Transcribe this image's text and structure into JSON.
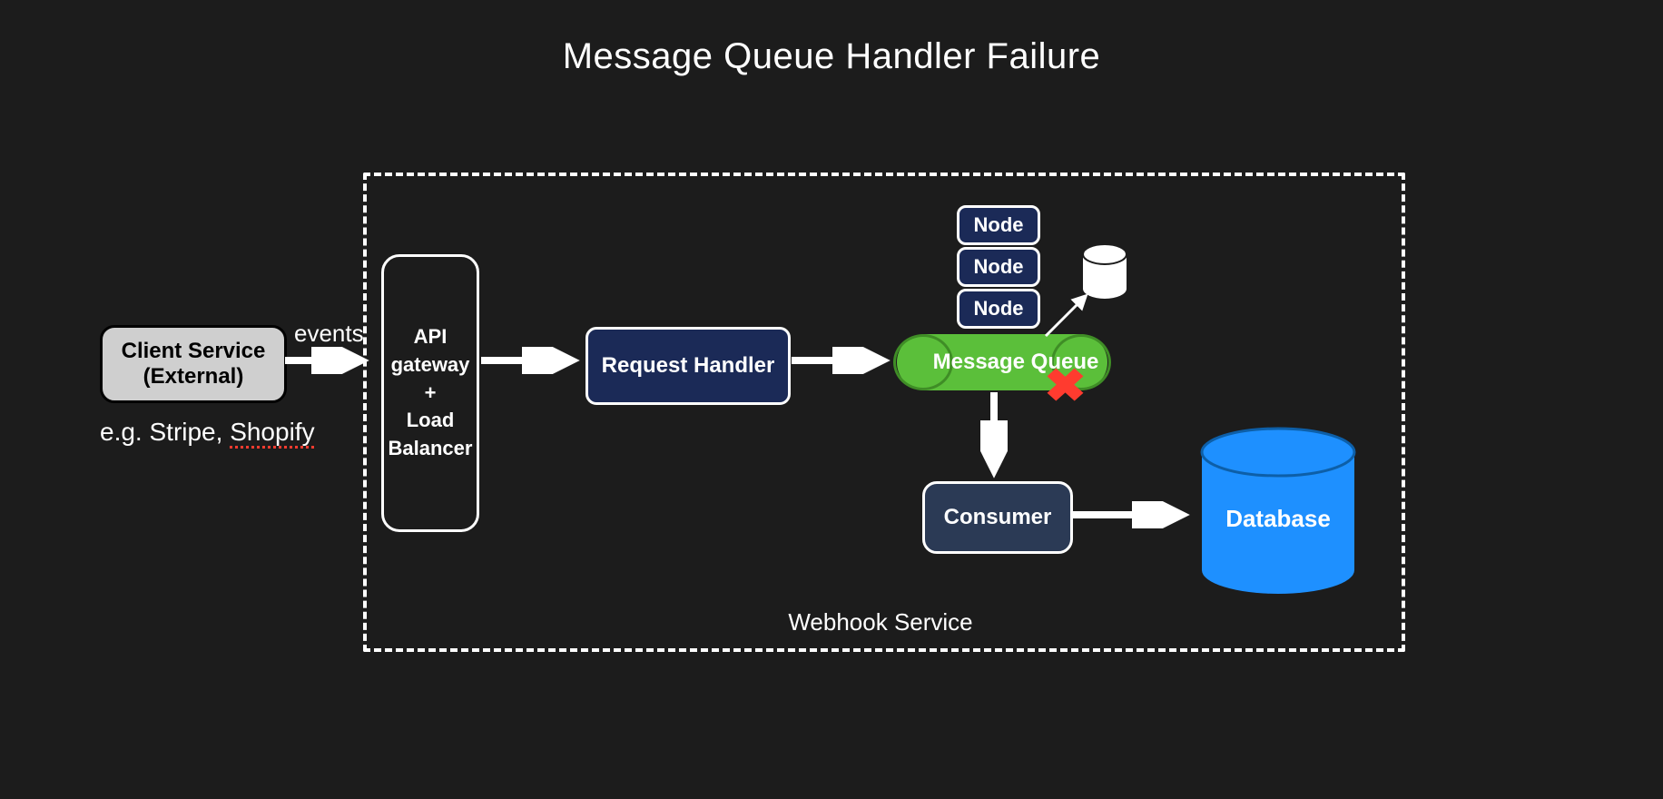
{
  "title": "Message Queue Handler Failure",
  "client": {
    "label": "Client Service\n(External)",
    "examples_prefix": "e.g. Stripe, ",
    "examples_marked": "Shopify"
  },
  "labels": {
    "events": "events",
    "webhook_service": "Webhook Service"
  },
  "gateway": {
    "label": "API\ngateway\n+\nLoad\nBalancer"
  },
  "request_handler": {
    "label": "Request Handler"
  },
  "nodes": [
    "Node",
    "Node",
    "Node"
  ],
  "queue": {
    "label": "Message Queue"
  },
  "consumer": {
    "label": "Consumer"
  },
  "database": {
    "label": "Database"
  },
  "diagram": {
    "type": "architecture",
    "container": "Webhook Service",
    "components": [
      {
        "id": "client",
        "name": "Client Service (External)",
        "note": "e.g. Stripe, Shopify"
      },
      {
        "id": "gateway",
        "name": "API gateway + Load Balancer"
      },
      {
        "id": "request_handler",
        "name": "Request Handler"
      },
      {
        "id": "message_queue",
        "name": "Message Queue",
        "replicas": [
          "Node",
          "Node",
          "Node"
        ],
        "persistence": true,
        "status": "failure"
      },
      {
        "id": "consumer",
        "name": "Consumer"
      },
      {
        "id": "database",
        "name": "Database"
      }
    ],
    "edges": [
      {
        "from": "client",
        "to": "gateway",
        "label": "events"
      },
      {
        "from": "gateway",
        "to": "request_handler"
      },
      {
        "from": "request_handler",
        "to": "message_queue"
      },
      {
        "from": "message_queue",
        "to": "consumer"
      },
      {
        "from": "consumer",
        "to": "database"
      },
      {
        "from": "message_queue",
        "to": "persistence_disk"
      }
    ]
  }
}
